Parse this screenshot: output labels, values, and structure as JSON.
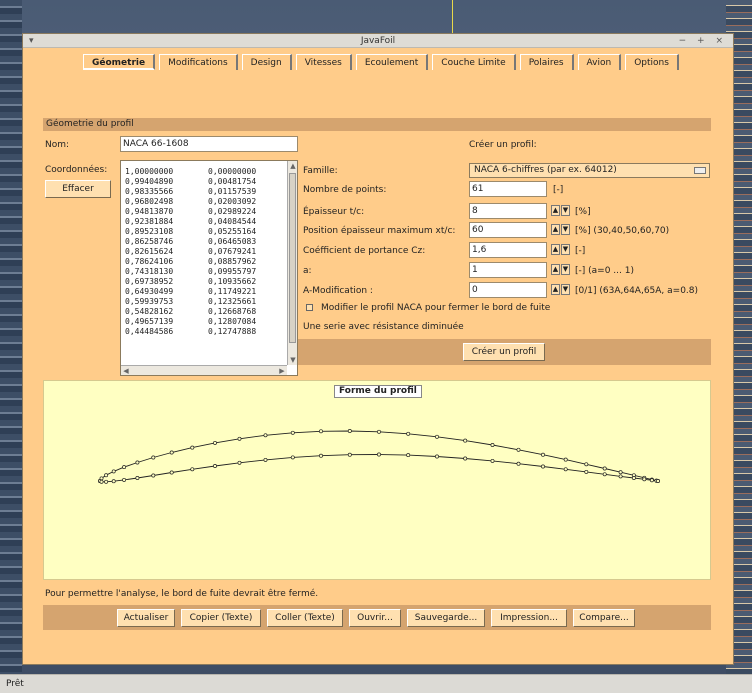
{
  "window": {
    "title": "JavaFoil",
    "controls": "− + ×"
  },
  "tabs": [
    {
      "label": "Géometrie",
      "active": true
    },
    {
      "label": "Modifications"
    },
    {
      "label": "Design"
    },
    {
      "label": "Vitesses"
    },
    {
      "label": "Ecoulement"
    },
    {
      "label": "Couche Limite"
    },
    {
      "label": "Polaires"
    },
    {
      "label": "Avion"
    },
    {
      "label": "Options"
    }
  ],
  "geometry": {
    "section_title": "Géometrie du profil",
    "name_label": "Nom:",
    "name_value": "NACA 66-1608",
    "coords_label": "Coordonnées:",
    "clear_button": "Effacer",
    "coordinates": [
      [
        "1,00000000",
        "0,00000000"
      ],
      [
        "0,99404890",
        "0,00481754"
      ],
      [
        "0,98335566",
        "0,01157539"
      ],
      [
        "0,96802498",
        "0,02003092"
      ],
      [
        "0,94813870",
        "0,02989224"
      ],
      [
        "0,92381884",
        "0,04084544"
      ],
      [
        "0,89523108",
        "0,05255164"
      ],
      [
        "0,86258746",
        "0,06465083"
      ],
      [
        "0,82615624",
        "0,07679241"
      ],
      [
        "0,78624106",
        "0,08857962"
      ],
      [
        "0,74318130",
        "0,09955797"
      ],
      [
        "0,69738952",
        "0,10935662"
      ],
      [
        "0,64930499",
        "0,11749221"
      ],
      [
        "0,59939753",
        "0,12325661"
      ],
      [
        "0,54828162",
        "0,12668768"
      ],
      [
        "0,49657139",
        "0,12807084"
      ],
      [
        "0,44484586",
        "0,12747888"
      ]
    ]
  },
  "creator": {
    "title": "Créer un profil:",
    "family_label": "Famille:",
    "family_value": "NACA 6-chiffres (par ex. 64012)",
    "fields": [
      {
        "label": "Nombre de points:",
        "value": "61",
        "unit": "[-]",
        "spin": false
      },
      {
        "label": "Épaisseur  t/c:",
        "value": "8",
        "unit": "[%]",
        "spin": true
      },
      {
        "label": "Position épaisseur maximum  xt/c:",
        "value": "60",
        "unit": "[%]  (30,40,50,60,70)",
        "spin": true
      },
      {
        "label": "Coéfficient de portance  Cz:",
        "value": "1,6",
        "unit": "[-]",
        "spin": true
      },
      {
        "label": "a:",
        "value": "1",
        "unit": "[-]  (a=0 ... 1)",
        "spin": true
      },
      {
        "label": "A-Modification  :",
        "value": "0",
        "unit": "[0/1]  (63A,64A,65A, a=0.8)",
        "spin": true
      }
    ],
    "checkbox_label": "Modifier le profil NACA pour fermer le bord de fuite",
    "note": "Une serie avec résistance diminuée",
    "create_button": "Créer un profil"
  },
  "plot": {
    "title": "Forme du profil"
  },
  "warning": "Pour permettre l'analyse, le bord de fuite devrait être fermé.",
  "actions": {
    "update": "Actualiser",
    "copy": "Copier (Texte)",
    "paste": "Coller (Texte)",
    "open": "Ouvrir...",
    "save": "Sauvegarde...",
    "print": "Impression...",
    "compare": "Compare..."
  },
  "status": "Prêt"
}
